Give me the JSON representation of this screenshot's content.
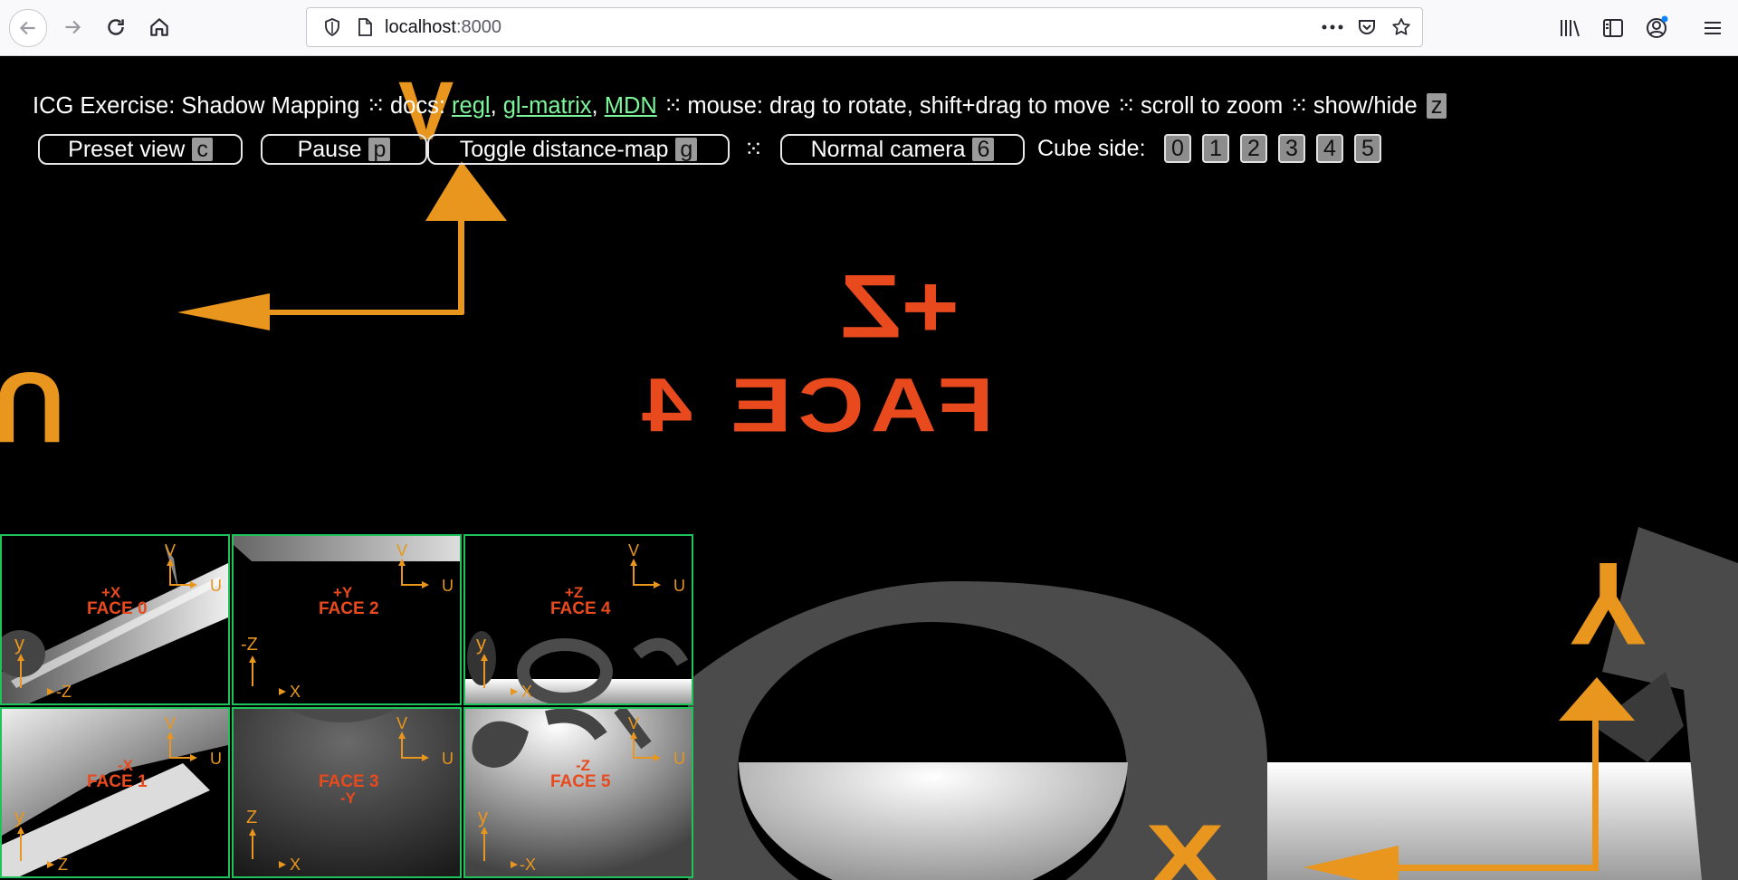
{
  "browser": {
    "url_host": "localhost",
    "url_port": ":8000",
    "icons": [
      "back-icon",
      "forward-icon",
      "reload-icon",
      "home-icon",
      "shield-icon",
      "page-icon",
      "more-icon",
      "pocket-icon",
      "bookmark-star-icon",
      "library-icon",
      "sidebar-icon",
      "account-icon",
      "menu-icon"
    ]
  },
  "header": {
    "title": "ICG Exercise: Shadow Mapping",
    "sep": "⁙",
    "docs_label": "docs:",
    "link_regl": "regl",
    "comma": ",",
    "link_glmatrix": "gl-matrix",
    "link_mdn": "MDN",
    "mouse_text": "mouse: drag to rotate, shift+drag to move",
    "scroll_text": "scroll to zoom",
    "showhide_text": "show/hide",
    "showhide_key": "z"
  },
  "controls": {
    "preset_label": "Preset view",
    "preset_key": "c",
    "pause_label": "Pause",
    "pause_key": "p",
    "toggle_label": "Toggle distance-map",
    "toggle_key": "g",
    "sep": "⁙",
    "camera_label": "Normal camera",
    "camera_key": "6",
    "cube_side_label": "Cube side:",
    "cube_sides": [
      "0",
      "1",
      "2",
      "3",
      "4",
      "5"
    ]
  },
  "scene": {
    "axis_v": "V",
    "axis_u": "U",
    "face_sign": "+Z",
    "face_name": "FACE 4",
    "axis_x": "X",
    "axis_y": "Y"
  },
  "faces": [
    {
      "sign": "+X",
      "name": "FACE 0",
      "v": "V",
      "u": "U",
      "left_axis": "y",
      "bottom_axis": "-Z"
    },
    {
      "sign": "+Y",
      "name": "FACE 2",
      "v": "V",
      "u": "U",
      "left_axis": "-Z",
      "bottom_axis": "X"
    },
    {
      "sign": "+Z",
      "name": "FACE 4",
      "v": "V",
      "u": "U",
      "left_axis": "y",
      "bottom_axis": "X"
    },
    {
      "sign": "-X",
      "name": "FACE 1",
      "v": "V",
      "u": "U",
      "left_axis": "y",
      "bottom_axis": "Z"
    },
    {
      "sign": "-Y",
      "name": "FACE 3",
      "v": "V",
      "u": "U",
      "left_axis": "Z",
      "bottom_axis": "X"
    },
    {
      "sign": "-Z",
      "name": "FACE 5",
      "v": "V",
      "u": "U",
      "left_axis": "y",
      "bottom_axis": "-X"
    }
  ],
  "colors": {
    "orange": "#e8961e",
    "red_text": "#e84a1e",
    "link": "#7cf59b",
    "grid_border": "#1ec45a"
  }
}
